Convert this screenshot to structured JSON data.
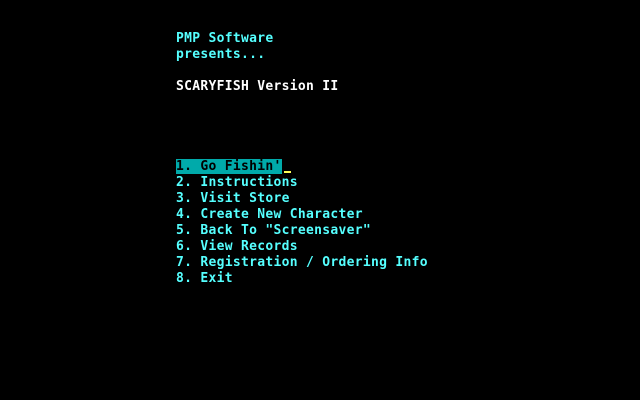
{
  "intro": {
    "publisher": "PMP Software",
    "presents": "presents...",
    "title": "SCARYFISH Version II"
  },
  "menu": {
    "items": [
      {
        "label": "1. Go Fishin'",
        "selected": true
      },
      {
        "label": "2. Instructions",
        "selected": false
      },
      {
        "label": "3. Visit Store",
        "selected": false
      },
      {
        "label": "4. Create New Character",
        "selected": false
      },
      {
        "label": "5. Back To \"Screensaver\"",
        "selected": false
      },
      {
        "label": "6. View Records",
        "selected": false
      },
      {
        "label": "7. Registration / Ordering Info",
        "selected": false
      },
      {
        "label": "8. Exit",
        "selected": false
      }
    ]
  },
  "colors": {
    "background": "#000000",
    "menu_text": "#55ffff",
    "title_text": "#ffffff",
    "highlight_bg": "#00aaaa",
    "cursor": "#ffff55"
  }
}
